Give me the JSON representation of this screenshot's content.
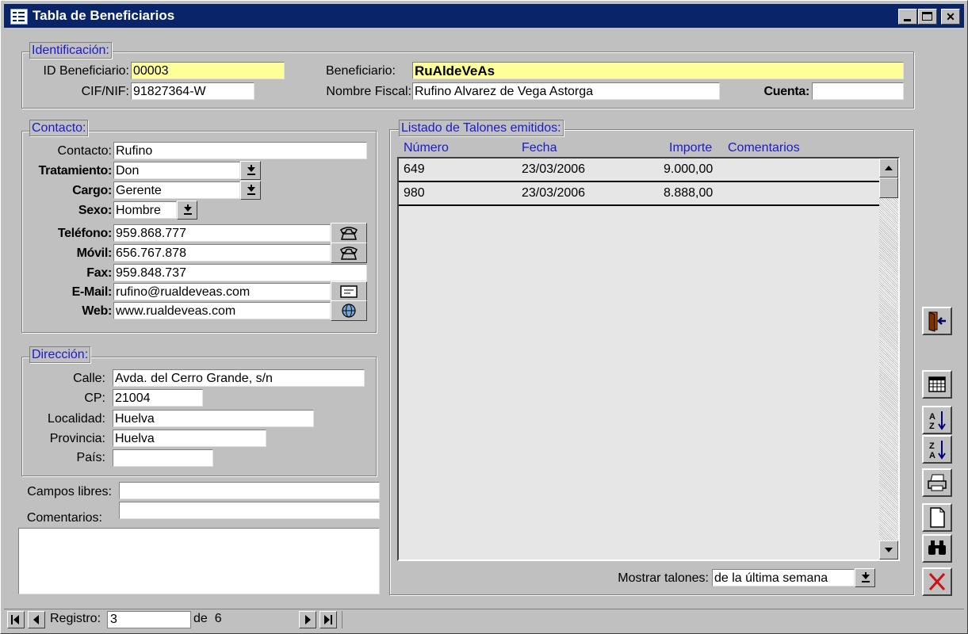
{
  "window": {
    "title": "Tabla de Beneficiarios"
  },
  "identificacion": {
    "legend": "Identificación:",
    "id_label": "ID Beneficiario:",
    "id_value": "00003",
    "cif_label": "CIF/NIF:",
    "cif_value": "91827364-W",
    "benef_label": "Beneficiario:",
    "benef_value": "RuAldeVeAs",
    "nombre_label": "Nombre Fiscal:",
    "nombre_value": "Rufino Alvarez de Vega Astorga",
    "cuenta_label": "Cuenta:",
    "cuenta_value": ""
  },
  "contacto": {
    "legend": "Contacto:",
    "contacto_label": "Contacto:",
    "contacto_value": "Rufino",
    "tratamiento_label": "Tratamiento:",
    "tratamiento_value": "Don",
    "cargo_label": "Cargo:",
    "cargo_value": "Gerente",
    "sexo_label": "Sexo:",
    "sexo_value": "Hombre",
    "telefono_label": "Teléfono:",
    "telefono_value": "959.868.777",
    "movil_label": "Móvil:",
    "movil_value": "656.767.878",
    "fax_label": "Fax:",
    "fax_value": "959.848.737",
    "email_label": "E-Mail:",
    "email_value": "rufino@rualdeveas.com",
    "web_label": "Web:",
    "web_value": "www.rualdeveas.com"
  },
  "direccion": {
    "legend": "Dirección:",
    "calle_label": "Calle:",
    "calle_value": "Avda. del Cerro Grande, s/n",
    "cp_label": "CP:",
    "cp_value": "21004",
    "localidad_label": "Localidad:",
    "localidad_value": "Huelva",
    "provincia_label": "Provincia:",
    "provincia_value": "Huelva",
    "pais_label": "País:",
    "pais_value": ""
  },
  "extra": {
    "campos_label": "Campos libres:",
    "campos_value1": "",
    "campos_value2": "",
    "comentarios_label": "Comentarios:",
    "comentarios_value": ""
  },
  "talones": {
    "legend": "Listado de Talones emitidos:",
    "headers": [
      "Número",
      "Fecha",
      "Importe",
      "Comentarios"
    ],
    "rows": [
      {
        "numero": "649",
        "fecha": "23/03/2006",
        "importe": "9.000,00",
        "comentarios": ""
      },
      {
        "numero": "980",
        "fecha": "23/03/2006",
        "importe": "8.888,00",
        "comentarios": ""
      }
    ],
    "mostrar_label": "Mostrar talones:",
    "mostrar_value": "de la última semana"
  },
  "statusbar": {
    "registro_label": "Registro:",
    "registro_value": "3",
    "de_label": "de",
    "total": "6"
  },
  "colors": {
    "titlebar": "#0a246a",
    "highlight_field": "#ffff99",
    "legend_text": "#1a1acc"
  }
}
